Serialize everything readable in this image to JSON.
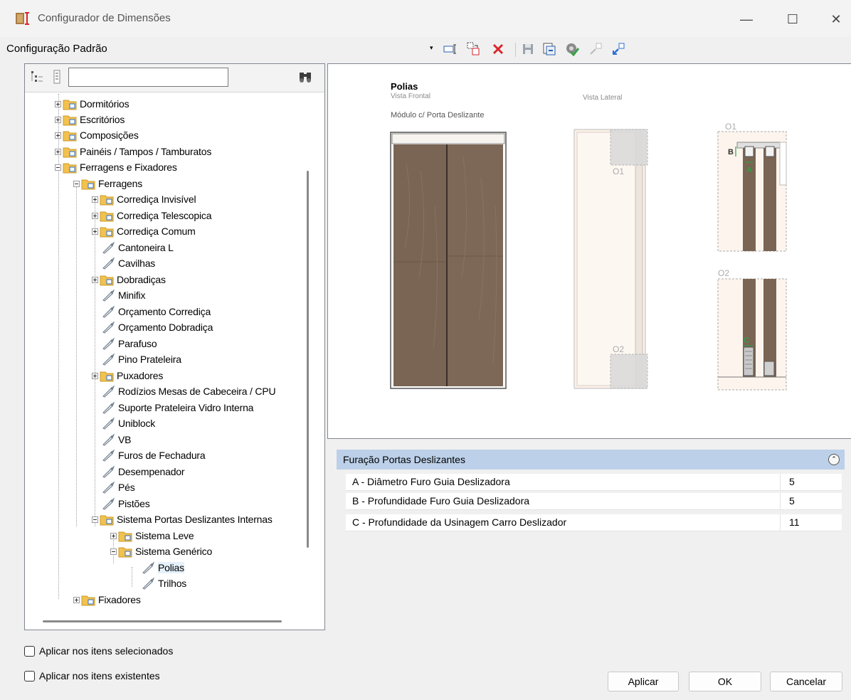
{
  "window": {
    "title": "Configurador de Dimensões",
    "minimize": "—",
    "maximize": "☐",
    "close": "✕"
  },
  "toolbar": {
    "config_label": "Configuração Padrão",
    "dropdown_arrow": "▾"
  },
  "tree": {
    "search_value": "",
    "items": [
      {
        "label": "Dormitórios"
      },
      {
        "label": "Escritórios"
      },
      {
        "label": "Composições"
      },
      {
        "label": "Painéis / Tampos / Tamburatos"
      },
      {
        "label": "Ferragens e Fixadores"
      },
      {
        "label": "Ferragens"
      },
      {
        "label": "Corrediça Invisível"
      },
      {
        "label": "Corrediça Telescopica"
      },
      {
        "label": "Corrediça Comum"
      },
      {
        "label": "Cantoneira L"
      },
      {
        "label": "Cavilhas"
      },
      {
        "label": "Dobradiças"
      },
      {
        "label": "Minifix"
      },
      {
        "label": "Orçamento Corrediça"
      },
      {
        "label": "Orçamento Dobradiça"
      },
      {
        "label": "Parafuso"
      },
      {
        "label": "Pino Prateleira"
      },
      {
        "label": "Puxadores"
      },
      {
        "label": "Rodízios Mesas de Cabeceira / CPU"
      },
      {
        "label": "Suporte Prateleira Vidro Interna"
      },
      {
        "label": "Uniblock"
      },
      {
        "label": "VB"
      },
      {
        "label": "Furos de Fechadura"
      },
      {
        "label": "Desempenador"
      },
      {
        "label": "Pés"
      },
      {
        "label": "Pistões"
      },
      {
        "label": "Sistema Portas Deslizantes Internas"
      },
      {
        "label": "Sistema Leve"
      },
      {
        "label": "Sistema Genérico"
      },
      {
        "label": "Polias"
      },
      {
        "label": "Trilhos"
      },
      {
        "label": "Fixadores"
      }
    ]
  },
  "options": {
    "apply_selected": "Aplicar nos itens selecionados",
    "apply_existing": "Aplicar nos itens existentes"
  },
  "preview": {
    "title": "Polias",
    "front_view": "Vista Frontal",
    "side_view": "Vista Lateral",
    "module": "Módulo c/ Porta Deslizante",
    "o1": "O1",
    "o2": "O2",
    "label_a": "A",
    "label_b": "B",
    "label_c": "C"
  },
  "properties": {
    "header": "Furação Portas Deslizantes",
    "collapse_icon": "⌃",
    "rows": [
      {
        "name": "A - Diâmetro Furo Guia Deslizadora",
        "value": "5"
      },
      {
        "name": "B - Profundidade Furo Guia Deslizadora",
        "value": "5"
      },
      {
        "name": "C - Profundidade da Usinagem Carro Deslizador",
        "value": "11"
      }
    ]
  },
  "buttons": {
    "apply": "Aplicar",
    "ok": "OK",
    "cancel": "Cancelar"
  },
  "colors": {
    "wood": "#7a6453",
    "panel_header": "#bcd0e9",
    "remove_red": "#d9262b",
    "check_green": "#3aa04a",
    "folder_yellow": "#f2c14e"
  }
}
